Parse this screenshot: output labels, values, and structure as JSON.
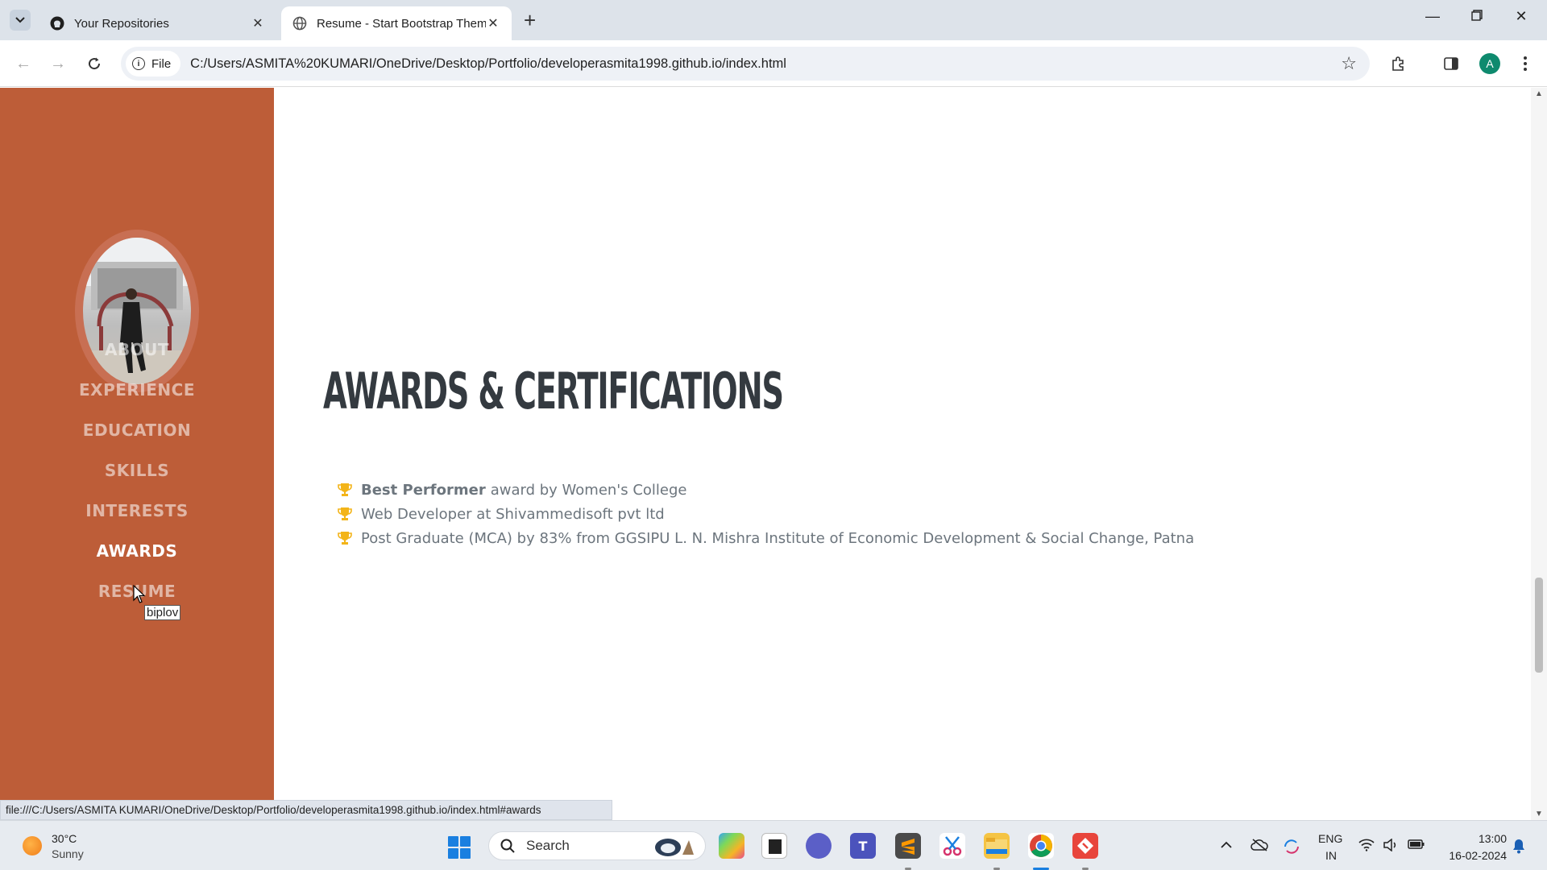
{
  "browser": {
    "tabs": [
      {
        "title": "Your Repositories",
        "active": false
      },
      {
        "title": "Resume - Start Bootstrap Them",
        "active": true
      }
    ],
    "chip_label": "File",
    "url": "C:/Users/ASMITA%20KUMARI/OneDrive/Desktop/Portfolio/developerasmita1998.github.io/index.html",
    "profile_initial": "A",
    "status_url": "file:///C:/Users/ASMITA KUMARI/OneDrive/Desktop/Portfolio/developerasmita1998.github.io/index.html#awards"
  },
  "sidebar": {
    "nav": [
      {
        "label": "ABOUT",
        "active": false
      },
      {
        "label": "EXPERIENCE",
        "active": false
      },
      {
        "label": "EDUCATION",
        "active": false
      },
      {
        "label": "SKILLS",
        "active": false
      },
      {
        "label": "INTERESTS",
        "active": false
      },
      {
        "label": "AWARDS",
        "active": true
      },
      {
        "label": "RESUME",
        "active": false
      }
    ],
    "tooltip": "biplov"
  },
  "main": {
    "heading": "AWARDS & CERTIFICATIONS",
    "awards": [
      {
        "bold": "Best Performer",
        "text": "award by Women's College"
      },
      {
        "bold": "",
        "text": "Web Developer at Shivammedisoft pvt ltd"
      },
      {
        "bold": "",
        "text": "Post Graduate (MCA) by 83% from GGSIPU L. N. Mishra Institute of Economic Development & Social Change, Patna"
      }
    ]
  },
  "taskbar": {
    "weather_temp": "30°C",
    "weather_desc": "Sunny",
    "search_label": "Search",
    "lang_line1": "ENG",
    "lang_line2": "IN",
    "time": "13:00",
    "date": "16-02-2024"
  },
  "colors": {
    "sidebar": "#bd5d38",
    "heading": "#343a40",
    "body_text": "#6c757d",
    "trophy": "#f3b418"
  }
}
